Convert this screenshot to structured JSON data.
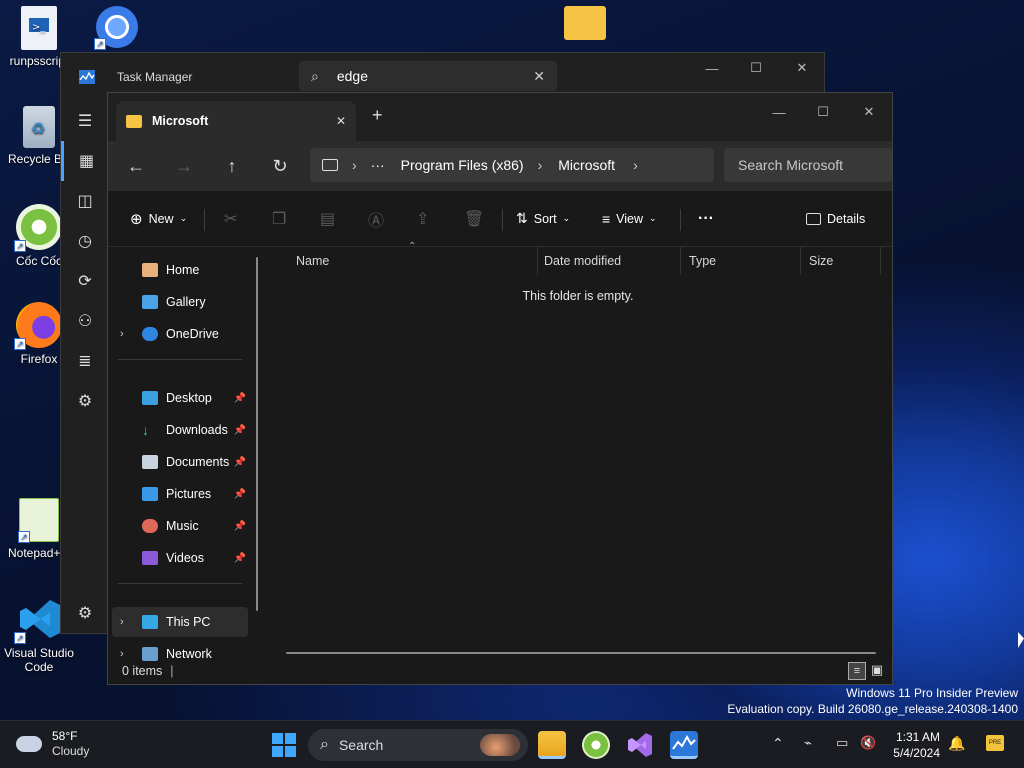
{
  "desktop": {
    "icons": [
      {
        "label": "runpsscript"
      },
      {
        "label": "Recycle Bin"
      },
      {
        "label": "Cốc Cốc"
      },
      {
        "label": "Firefox"
      },
      {
        "label": "Notepad++"
      },
      {
        "label": "Visual Studio Code"
      }
    ],
    "watermark_line1": "Windows 11 Pro Insider Preview",
    "watermark_line2": "Evaluation copy. Build 26080.ge_release.240308-1400"
  },
  "task_manager": {
    "title": "Task Manager",
    "search_value": "edge"
  },
  "explorer": {
    "tab_title": "Microsoft",
    "new_tab_symbol": "+",
    "breadcrumb": {
      "more": "···",
      "segments": [
        "Program Files (x86)",
        "Microsoft"
      ]
    },
    "search_placeholder": "Search Microsoft",
    "toolbar": {
      "new_label": "New",
      "sort_label": "Sort",
      "view_label": "View",
      "more_label": "···",
      "details_label": "Details"
    },
    "nav": {
      "home": "Home",
      "gallery": "Gallery",
      "onedrive": "OneDrive",
      "desktop": "Desktop",
      "downloads": "Downloads",
      "documents": "Documents",
      "pictures": "Pictures",
      "music": "Music",
      "videos": "Videos",
      "this_pc": "This PC",
      "network": "Network"
    },
    "columns": {
      "name": "Name",
      "date_modified": "Date modified",
      "type": "Type",
      "size": "Size"
    },
    "empty_message": "This folder is empty.",
    "status_text": "0 items"
  },
  "taskbar": {
    "weather_temp": "58°F",
    "weather_desc": "Cloudy",
    "search_label": "Search",
    "time": "1:31 AM",
    "date": "5/4/2024"
  },
  "colors": {
    "accent": "#0078d4",
    "folder_yellow": "#f6c344"
  }
}
